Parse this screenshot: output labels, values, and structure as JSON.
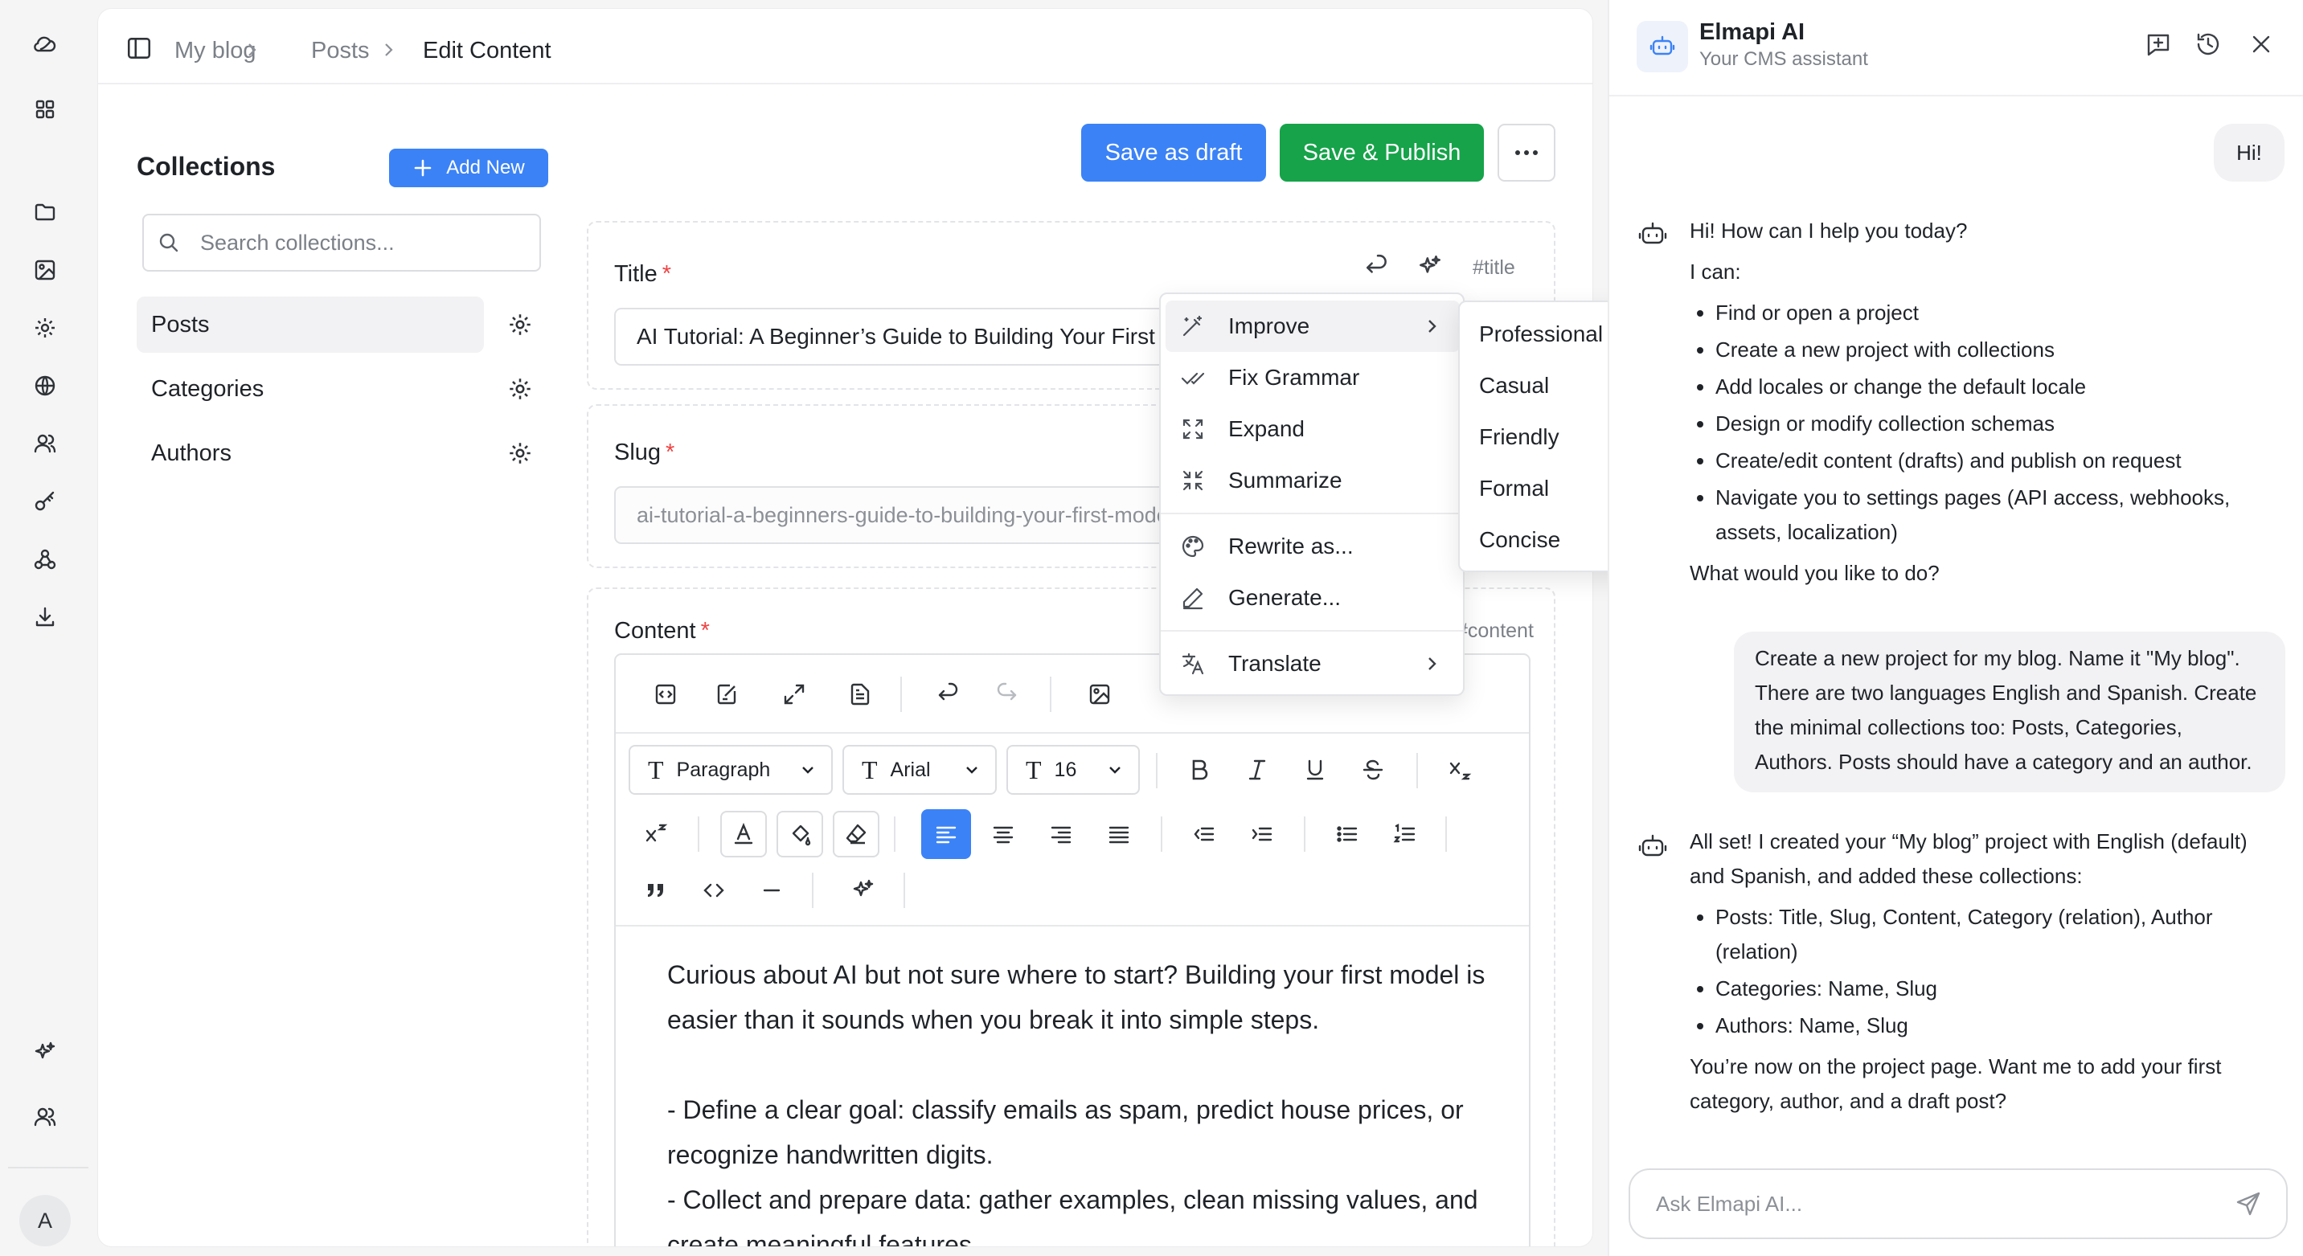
{
  "breadcrumb": {
    "root": "My blog",
    "section": "Posts",
    "current": "Edit Content"
  },
  "collections": {
    "title": "Collections",
    "add_label": "Add New",
    "search_placeholder": "Search collections...",
    "items": [
      {
        "label": "Posts"
      },
      {
        "label": "Categories"
      },
      {
        "label": "Authors"
      }
    ]
  },
  "actions": {
    "draft": "Save as draft",
    "publish": "Save & Publish"
  },
  "fields": {
    "title": {
      "label": "Title",
      "value": "AI Tutorial: A Beginner’s Guide to Building Your First Model",
      "tag": "#title"
    },
    "slug": {
      "label": "Slug",
      "value": "ai-tutorial-a-beginners-guide-to-building-your-first-model"
    },
    "content": {
      "label": "Content",
      "tag": "#content",
      "block_type": "Paragraph",
      "font": "Arial",
      "size": "16",
      "paragraphs": [
        "Curious about AI but not sure where to start? Building your first model is easier than it sounds when you break it into simple steps.",
        "- Define a clear goal: classify emails as spam, predict house prices, or recognize handwritten digits.",
        "- Collect and prepare data: gather examples, clean missing values, and create meaningful features."
      ]
    }
  },
  "required_mark": "*",
  "ai_menu": {
    "improve": "Improve",
    "fix_grammar": "Fix Grammar",
    "expand": "Expand",
    "summarize": "Summarize",
    "rewrite": "Rewrite as...",
    "generate": "Generate...",
    "translate": "Translate",
    "tones": [
      "Professional",
      "Casual",
      "Friendly",
      "Formal",
      "Concise"
    ]
  },
  "assistant": {
    "name": "Elmapi AI",
    "subtitle": "Your CMS assistant",
    "input_placeholder": "Ask Elmapi AI...",
    "messages": {
      "user1": "Hi!",
      "bot1_intro": "Hi! How can I help you today?",
      "bot1_lead": "I can:",
      "bot1_items": [
        "Find or open a project",
        "Create a new project with collections",
        "Add locales or change the default locale",
        "Design or modify collection schemas",
        "Create/edit content (drafts) and publish on request",
        "Navigate you to settings pages (API access, webhooks, assets, localization)"
      ],
      "bot1_outro": "What would you like to do?",
      "user2": "Create a new project for my blog. Name it \"My blog\". There are two languages English and Spanish. Create the minimal collections too: Posts, Categories, Authors. Posts should have a category and an author.",
      "bot2_intro": "All set! I created your “My blog” project with English (default) and Spanish, and added these collections:",
      "bot2_items": [
        "Posts: Title, Slug, Content, Category (relation), Author (relation)",
        "Categories: Name, Slug",
        "Authors: Name, Slug"
      ],
      "bot2_outro": "You’re now on the project page. Want me to add your first category, author, and a draft post?"
    }
  },
  "rail": {
    "avatar_letter": "A"
  }
}
